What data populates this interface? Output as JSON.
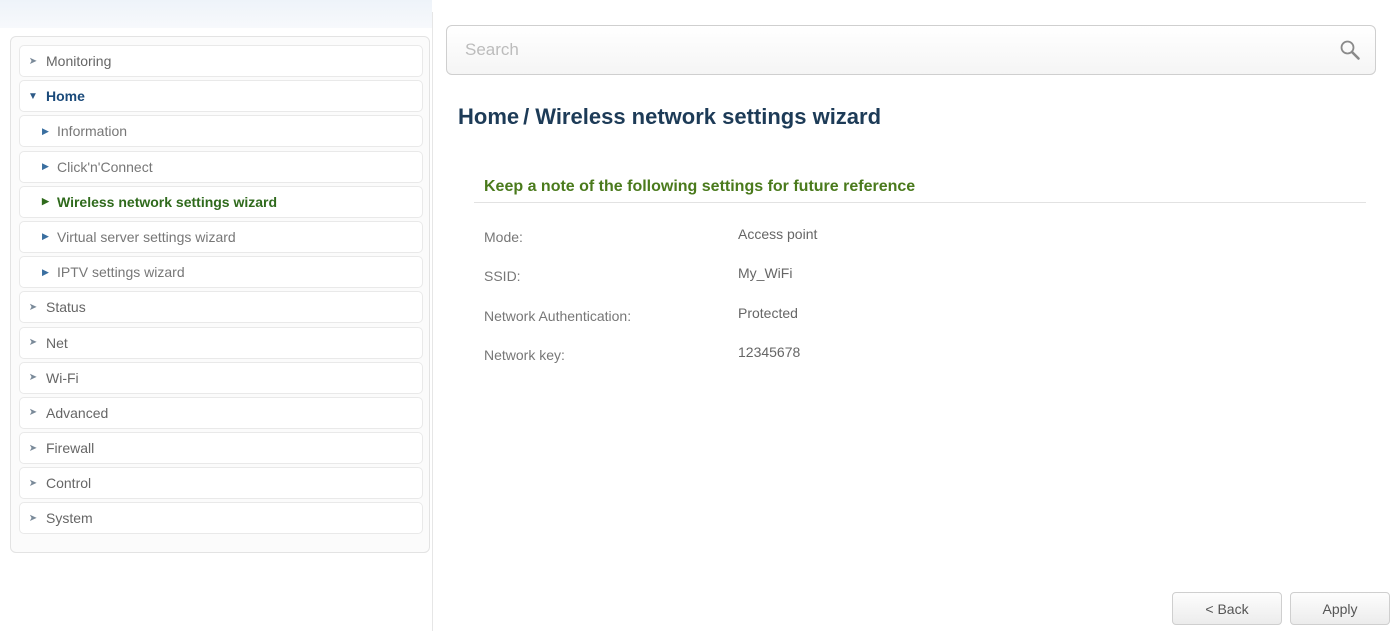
{
  "sidebar": {
    "items": [
      {
        "label": "Monitoring",
        "icon": "circle-arrow-icon",
        "level": 0,
        "state": "normal"
      },
      {
        "label": "Home",
        "icon": "circle-arrow-down-icon",
        "level": 0,
        "state": "expanded"
      },
      {
        "label": "Information",
        "icon": "triangle-right-icon",
        "level": 1,
        "state": "normal"
      },
      {
        "label": "Click'n'Connect",
        "icon": "triangle-right-icon",
        "level": 1,
        "state": "normal"
      },
      {
        "label": "Wireless network settings wizard",
        "icon": "triangle-right-icon",
        "level": 1,
        "state": "selected"
      },
      {
        "label": "Virtual server settings wizard",
        "icon": "triangle-right-icon",
        "level": 1,
        "state": "normal"
      },
      {
        "label": "IPTV settings wizard",
        "icon": "triangle-right-icon",
        "level": 1,
        "state": "normal"
      },
      {
        "label": "Status",
        "icon": "circle-arrow-icon",
        "level": 0,
        "state": "normal"
      },
      {
        "label": "Net",
        "icon": "circle-arrow-icon",
        "level": 0,
        "state": "normal"
      },
      {
        "label": "Wi-Fi",
        "icon": "circle-arrow-icon",
        "level": 0,
        "state": "normal"
      },
      {
        "label": "Advanced",
        "icon": "circle-arrow-icon",
        "level": 0,
        "state": "normal"
      },
      {
        "label": "Firewall",
        "icon": "circle-arrow-icon",
        "level": 0,
        "state": "normal"
      },
      {
        "label": "Control",
        "icon": "circle-arrow-icon",
        "level": 0,
        "state": "normal"
      },
      {
        "label": "System",
        "icon": "circle-arrow-icon",
        "level": 0,
        "state": "normal"
      }
    ]
  },
  "search": {
    "placeholder": "Search",
    "icon": "search-icon"
  },
  "breadcrumb": {
    "parent": "Home",
    "separator": "/",
    "current": "Wireless network settings wizard"
  },
  "section": {
    "title": "Keep a note of the following settings for future reference"
  },
  "fields": {
    "mode": {
      "label": "Mode:",
      "value": "Access point"
    },
    "ssid": {
      "label": "SSID:",
      "value": "My_WiFi"
    },
    "auth": {
      "label": "Network Authentication:",
      "value": "Protected"
    },
    "key": {
      "label": "Network key:",
      "value": "12345678"
    }
  },
  "buttons": {
    "back": "< Back",
    "apply": "Apply"
  },
  "colors": {
    "title": "#1d3b57",
    "section_title": "#4a7a1c",
    "selected_menu": "#2f6a1c",
    "expanded_menu": "#1a4a7a"
  }
}
